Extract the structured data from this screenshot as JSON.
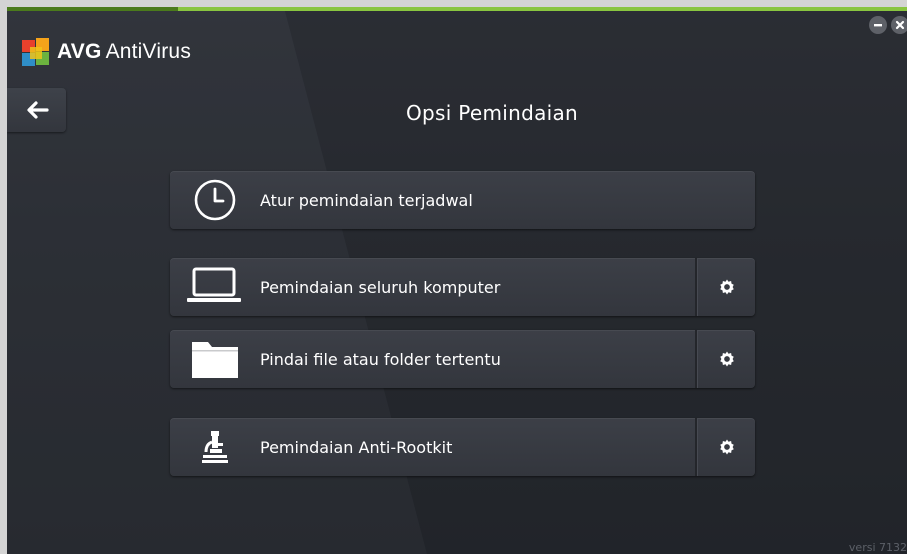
{
  "app": {
    "brand": "AVG",
    "product": "AntiVirus",
    "accent_color": "#89c540"
  },
  "window": {
    "minimize_icon": "minimize-icon",
    "close_icon": "close-icon"
  },
  "header": {
    "back_icon": "arrow-left-icon",
    "title": "Opsi Pemindaian"
  },
  "scan_options": [
    {
      "label": "Atur pemindaian terjadwal",
      "icon": "clock-icon",
      "has_settings": false
    },
    {
      "label": "Pemindaian seluruh komputer",
      "icon": "laptop-icon",
      "has_settings": true,
      "settings_icon": "gear-icon"
    },
    {
      "label": "Pindai file atau folder tertentu",
      "icon": "folder-icon",
      "has_settings": true,
      "settings_icon": "gear-icon"
    },
    {
      "label": "Pemindaian Anti-Rootkit",
      "icon": "microscope-icon",
      "has_settings": true,
      "settings_icon": "gear-icon"
    }
  ],
  "footer": {
    "version": "versi 7132"
  }
}
